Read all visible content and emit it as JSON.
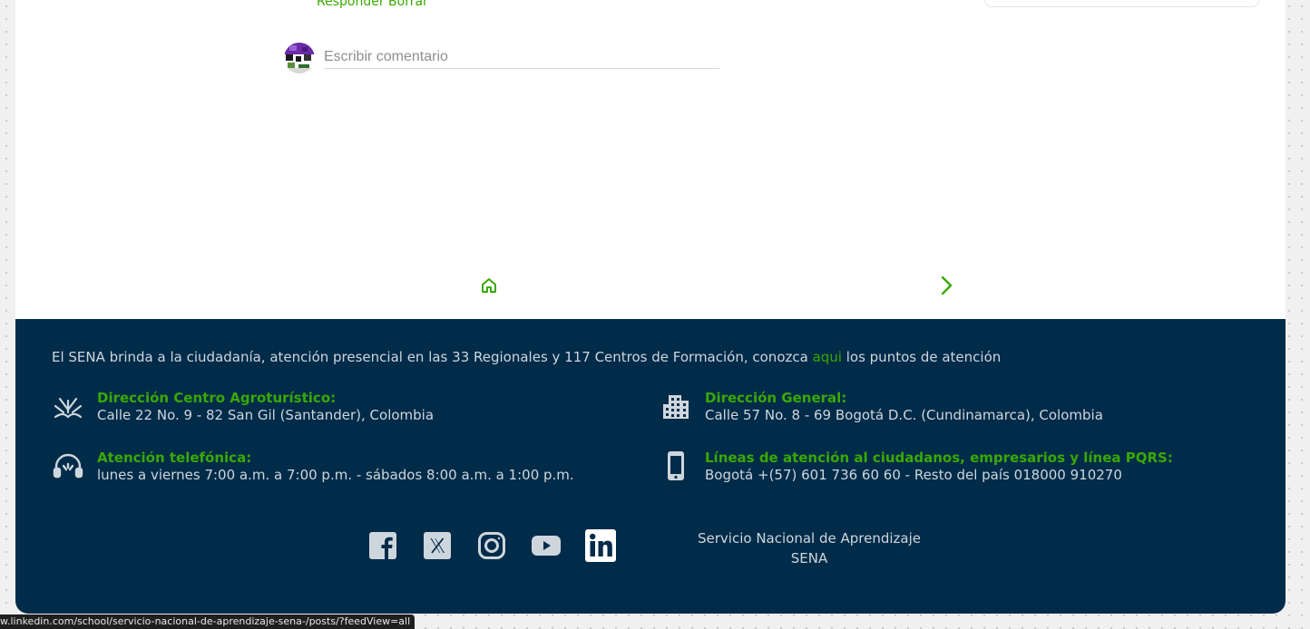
{
  "comments": {
    "reply_label": "Responder",
    "delete_label": "Borrar",
    "input_placeholder": "Escribir comentario"
  },
  "nav": {
    "home_icon": "home-icon",
    "next_icon": "chevron-right-icon"
  },
  "footer": {
    "intro_before": "El SENA brinda a la ciudadanía, atención presencial en las 33 Regionales y 117 Centros de Formación, conozca ",
    "intro_link": "aqui",
    "intro_after": " los puntos de atención",
    "blocks": [
      {
        "icon": "agro-plant-icon",
        "title": "Dirección Centro Agroturístico:",
        "text": "Calle 22 No. 9 - 82 San Gil (Santander), Colombia"
      },
      {
        "icon": "building-icon",
        "title": "Dirección General:",
        "text": "Calle 57 No. 8 - 69 Bogotá D.C. (Cundinamarca), Colombia"
      },
      {
        "icon": "headset-icon",
        "title": "Atención telefónica:",
        "text": "lunes a viernes 7:00 a.m. a 7:00 p.m. - sábados 8:00 a.m. a 1:00 p.m."
      },
      {
        "icon": "smartphone-icon",
        "title": "Líneas de atención al ciudadanos, empresarios y línea PQRS:",
        "text": "Bogotá +(57) 601 736 60 60 - Resto del país 018000 910270"
      }
    ],
    "social": [
      "facebook-icon",
      "x-twitter-icon",
      "instagram-icon",
      "youtube-icon",
      "linkedin-icon"
    ],
    "org_name": "Servicio Nacional de Aprendizaje",
    "org_short": "SENA"
  },
  "status_bar": {
    "url": "w.linkedin.com/school/servicio-nacional-de-aprendizaje-sena-/posts/?feedView=all"
  },
  "colors": {
    "accent_green": "#39a900",
    "footer_bg": "#002b49",
    "footer_text": "#ced6dd"
  }
}
